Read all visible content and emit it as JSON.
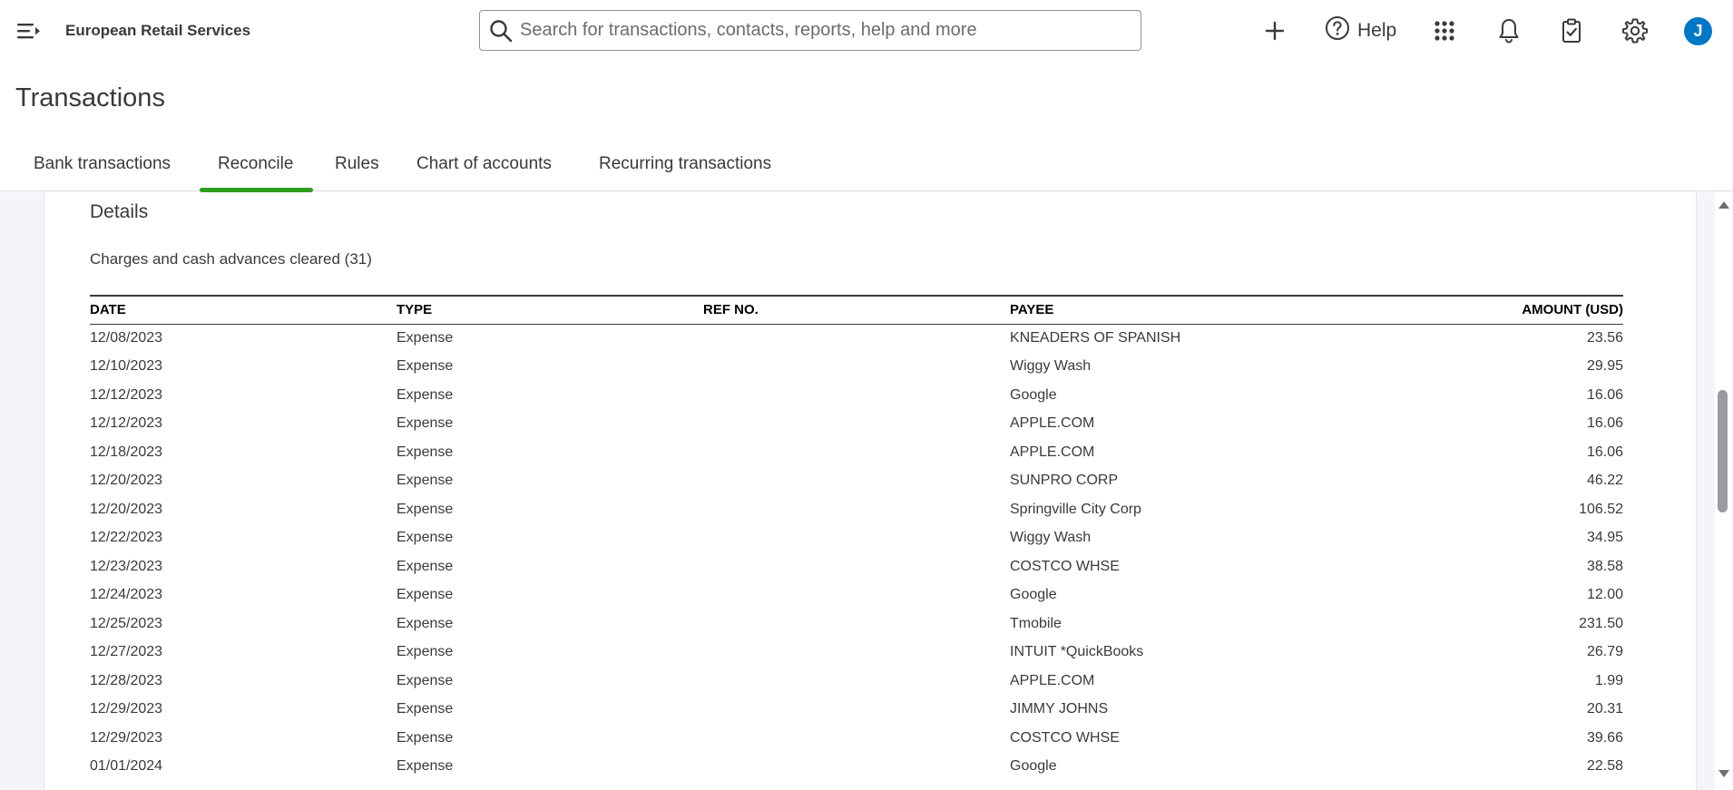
{
  "header": {
    "company_name": "European Retail Services",
    "search_placeholder": "Search for transactions, contacts, reports, help and more",
    "help_label": "Help",
    "avatar_initial": "J",
    "icons": [
      "menu-icon",
      "search-icon",
      "plus-icon",
      "help-icon",
      "apps-grid-icon",
      "bell-icon",
      "clipboard-check-icon",
      "gear-icon"
    ]
  },
  "page": {
    "title": "Transactions"
  },
  "tabs": [
    {
      "label": "Bank transactions",
      "active": false
    },
    {
      "label": "Reconcile",
      "active": true
    },
    {
      "label": "Rules",
      "active": false
    },
    {
      "label": "Chart of accounts",
      "active": false
    },
    {
      "label": "Recurring transactions",
      "active": false
    }
  ],
  "details": {
    "title": "Details",
    "section_label": "Charges and cash advances cleared (31)",
    "columns": {
      "date": "DATE",
      "type": "TYPE",
      "ref": "REF NO.",
      "payee": "PAYEE",
      "amount": "AMOUNT (USD)"
    },
    "rows": [
      {
        "date": "12/08/2023",
        "type": "Expense",
        "ref": "",
        "payee": "KNEADERS OF SPANISH",
        "amount": "23.56"
      },
      {
        "date": "12/10/2023",
        "type": "Expense",
        "ref": "",
        "payee": "Wiggy Wash",
        "amount": "29.95"
      },
      {
        "date": "12/12/2023",
        "type": "Expense",
        "ref": "",
        "payee": "Google",
        "amount": "16.06"
      },
      {
        "date": "12/12/2023",
        "type": "Expense",
        "ref": "",
        "payee": "APPLE.COM",
        "amount": "16.06"
      },
      {
        "date": "12/18/2023",
        "type": "Expense",
        "ref": "",
        "payee": "APPLE.COM",
        "amount": "16.06"
      },
      {
        "date": "12/20/2023",
        "type": "Expense",
        "ref": "",
        "payee": "SUNPRO CORP",
        "amount": "46.22"
      },
      {
        "date": "12/20/2023",
        "type": "Expense",
        "ref": "",
        "payee": "Springville City Corp",
        "amount": "106.52"
      },
      {
        "date": "12/22/2023",
        "type": "Expense",
        "ref": "",
        "payee": "Wiggy Wash",
        "amount": "34.95"
      },
      {
        "date": "12/23/2023",
        "type": "Expense",
        "ref": "",
        "payee": "COSTCO WHSE",
        "amount": "38.58"
      },
      {
        "date": "12/24/2023",
        "type": "Expense",
        "ref": "",
        "payee": "Google",
        "amount": "12.00"
      },
      {
        "date": "12/25/2023",
        "type": "Expense",
        "ref": "",
        "payee": "Tmobile",
        "amount": "231.50"
      },
      {
        "date": "12/27/2023",
        "type": "Expense",
        "ref": "",
        "payee": "INTUIT *QuickBooks",
        "amount": "26.79"
      },
      {
        "date": "12/28/2023",
        "type": "Expense",
        "ref": "",
        "payee": "APPLE.COM",
        "amount": "1.99"
      },
      {
        "date": "12/29/2023",
        "type": "Expense",
        "ref": "",
        "payee": "JIMMY JOHNS",
        "amount": "20.31"
      },
      {
        "date": "12/29/2023",
        "type": "Expense",
        "ref": "",
        "payee": "COSTCO WHSE",
        "amount": "39.66"
      },
      {
        "date": "01/01/2024",
        "type": "Expense",
        "ref": "",
        "payee": "Google",
        "amount": "22.58"
      }
    ]
  },
  "colors": {
    "accent_green": "#2ca01c",
    "avatar_blue": "#0077c5",
    "text": "#393a3d"
  }
}
